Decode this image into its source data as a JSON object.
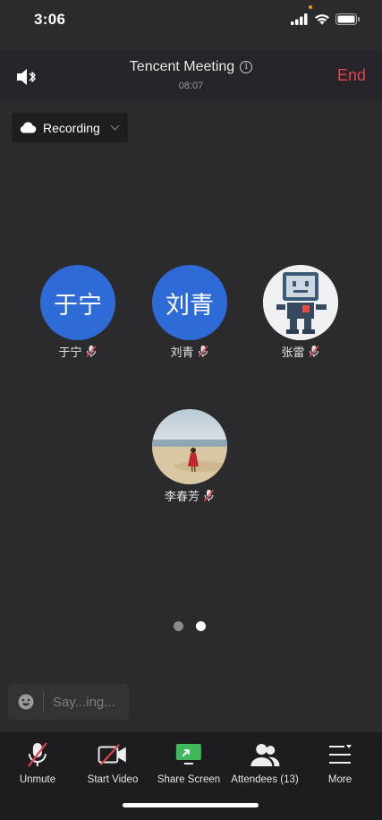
{
  "status": {
    "time": "3:06"
  },
  "header": {
    "title": "Tencent Meeting",
    "info_glyph": "i",
    "duration": "08:07",
    "end_label": "End"
  },
  "recording": {
    "label": "Recording"
  },
  "participants": [
    {
      "name": "于宁",
      "avatar_text": "于宁",
      "avatar_type": "initials",
      "muted": true
    },
    {
      "name": "刘青",
      "avatar_text": "刘青",
      "avatar_type": "initials",
      "muted": true
    },
    {
      "name": "张雷",
      "avatar_text": "",
      "avatar_type": "robot-photo",
      "muted": true
    },
    {
      "name": "李春芳",
      "avatar_text": "",
      "avatar_type": "beach-photo",
      "muted": true
    }
  ],
  "pagination": {
    "current": 2,
    "total": 2
  },
  "chat": {
    "placeholder": "Say...ing..."
  },
  "toolbar": {
    "unmute": "Unmute",
    "start_video": "Start Video",
    "share_screen": "Share Screen",
    "attendees": "Attendees (13)",
    "more": "More"
  },
  "colors": {
    "accent_blue": "#2f6bd6",
    "end_red": "#e0444a",
    "share_green": "#3dbb5a",
    "muted_red": "#e0444a"
  }
}
